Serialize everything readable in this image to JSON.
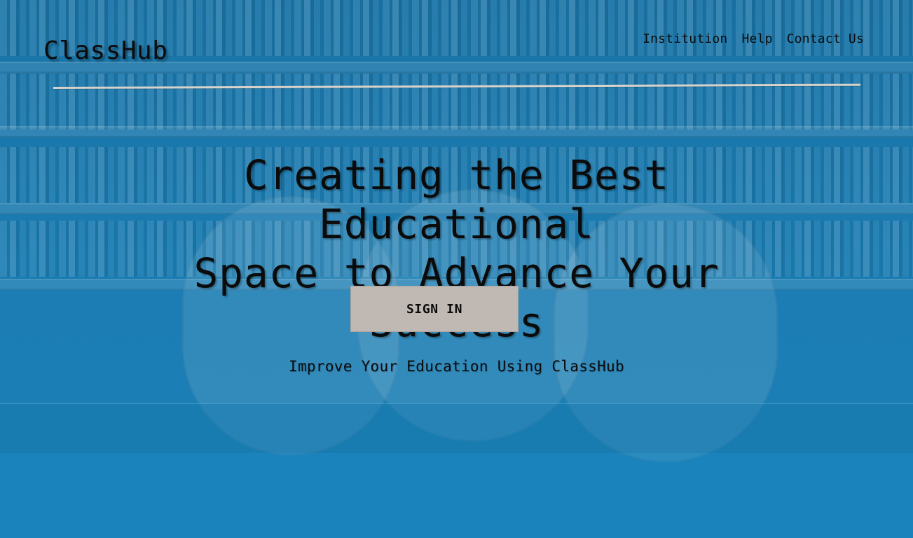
{
  "header": {
    "brand": "ClassHub",
    "nav": [
      {
        "label": "Institution"
      },
      {
        "label": "Help"
      },
      {
        "label": "Contact Us"
      }
    ]
  },
  "hero": {
    "title_line_1": "Creating the Best Educational",
    "title_line_2": "Space to Advance Your Success",
    "subtitle": "Improve Your Education Using ClassHub",
    "cta_label": "SIGN IN"
  },
  "colors": {
    "background_tint": "#1b7db3",
    "divider": "#d7d2cc",
    "button_bg": "#c0b9b3",
    "text": "#0b0b0b"
  }
}
